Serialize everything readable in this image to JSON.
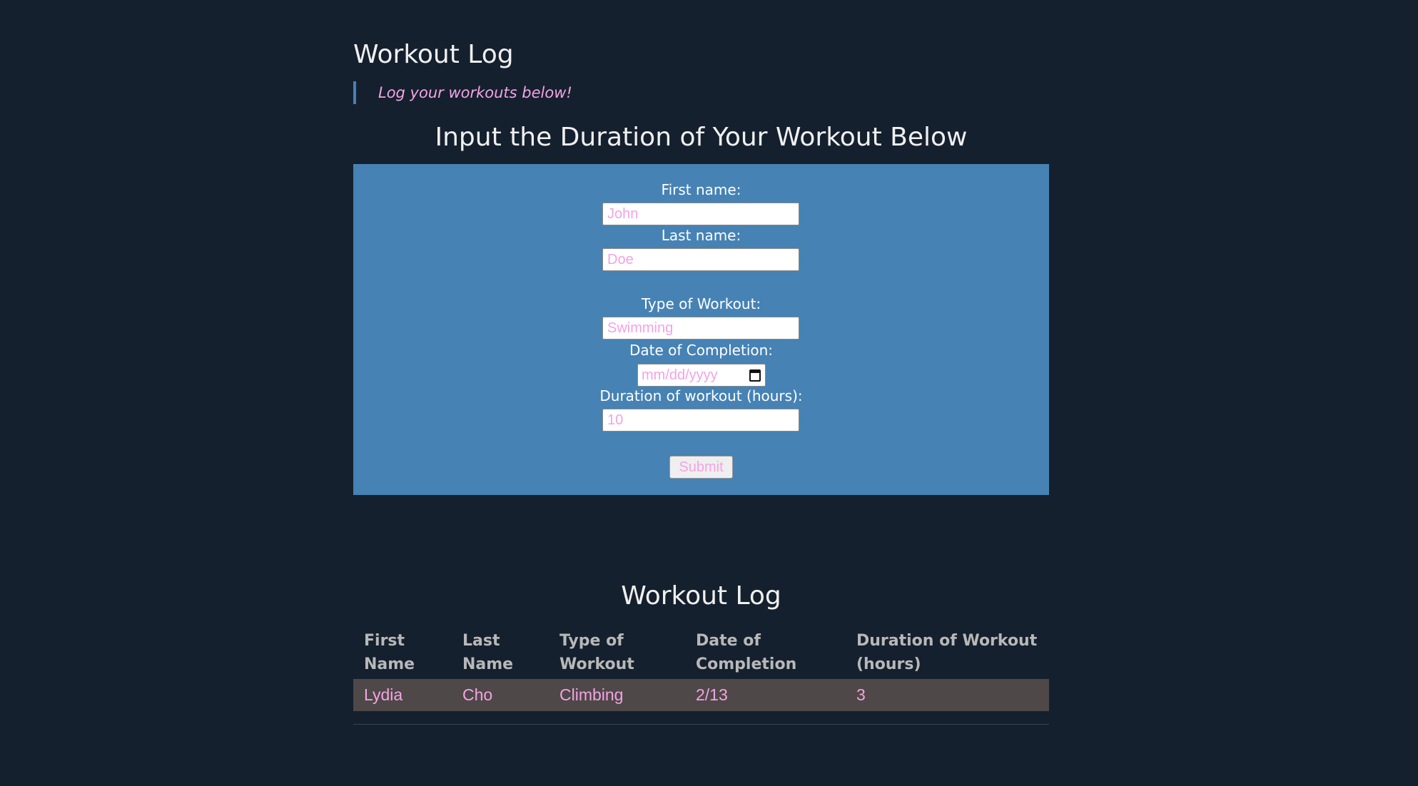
{
  "header": {
    "title": "Workout Log",
    "tagline": "Log your workouts below!"
  },
  "form": {
    "heading": "Input the Duration of Your Workout Below",
    "first_name_label": "First name:",
    "first_name_placeholder": "John",
    "last_name_label": "Last name:",
    "last_name_placeholder": "Doe",
    "workout_type_label": "Type of Workout:",
    "workout_type_placeholder": "Swimming",
    "date_label": "Date of Completion:",
    "date_placeholder": "mm/dd/yyyy",
    "duration_label": "Duration of workout (hours):",
    "duration_placeholder": "10",
    "submit_label": "Submit"
  },
  "log": {
    "heading": "Workout Log",
    "columns": [
      [
        "First",
        "Name"
      ],
      [
        "Last",
        "Name"
      ],
      [
        "Type of",
        "Workout"
      ],
      [
        "Date of",
        "Completion"
      ],
      [
        "Duration of Workout",
        "(hours)"
      ]
    ],
    "rows": [
      [
        "Lydia",
        "Cho",
        "Climbing",
        "2/13",
        "3"
      ]
    ]
  },
  "colors": {
    "background": "#15202e",
    "form_panel": "#4682b4",
    "accent_text": "#f3a3e3",
    "row_background": "#4f4848"
  },
  "icons": {
    "date_picker": "calendar-icon"
  }
}
